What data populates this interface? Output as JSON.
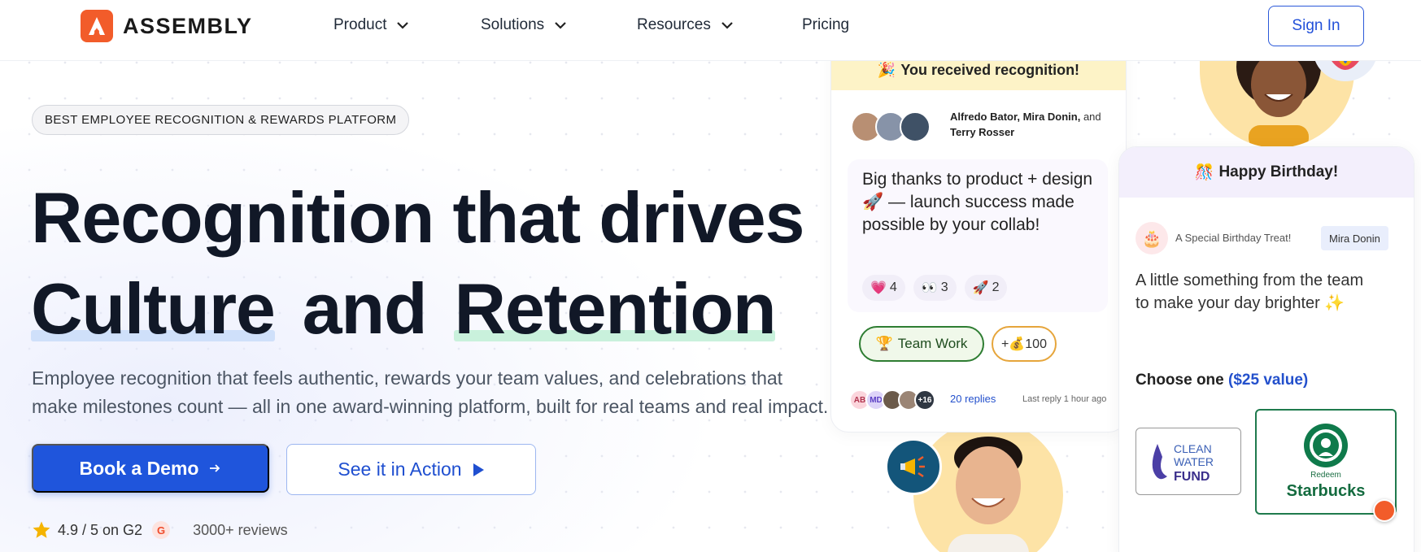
{
  "nav": {
    "logo_text": "ASSEMBLY",
    "items": [
      {
        "label": "Product",
        "has_dropdown": true
      },
      {
        "label": "Solutions",
        "has_dropdown": true
      },
      {
        "label": "Resources",
        "has_dropdown": true
      },
      {
        "label": "Pricing",
        "has_dropdown": false
      }
    ],
    "sign_in": "Sign In"
  },
  "hero": {
    "badge": "BEST EMPLOYEE RECOGNITION & REWARDS PLATFORM",
    "title_line1": "Recognition that drives",
    "title_word1": "Culture",
    "title_word2": "and",
    "title_word3": "Retention",
    "subtitle": "Employee recognition that feels authentic, rewards your team values, and celebrations that make milestones count — all in one award-winning platform, built for real teams and real impact.",
    "cta_primary": "Book a Demo",
    "cta_secondary": "See it in Action",
    "rating": "4.9 / 5 on G2",
    "g2": "G",
    "reviews": "3000+ reviews"
  },
  "recognition_card": {
    "header": "You received recognition!",
    "header_icon": "party-popper-icon",
    "senders": "Alfredo Bator, Mira Donin,",
    "senders_and": " and",
    "senders_last": "Terry Rosser",
    "message": "Big thanks to product + design 🚀 — launch success made possible by your collab!",
    "reactions": [
      {
        "emoji": "💗",
        "count": "4"
      },
      {
        "emoji": "👀",
        "count": "3"
      },
      {
        "emoji": "🚀",
        "count": "2"
      }
    ],
    "value_tag": "Team Work",
    "points": "+💰100",
    "reply_avatars": [
      "AB",
      "MD",
      "",
      "",
      "+16"
    ],
    "replies": "20 replies",
    "last_reply": "Last reply 1 hour ago"
  },
  "birthday_card": {
    "header": "Happy Birthday!",
    "header_icon": "gift-icon",
    "treat": "A Special Birthday Treat!",
    "recipient": "Mira Donin",
    "message": "A little something from the team to make your day brighter ✨",
    "choose": "Choose one",
    "choose_value": "($25 value)",
    "option1_lines": [
      "CLEAN",
      "WATER",
      "FUND"
    ],
    "option2_redeem": "Redeem",
    "option2_name": "Starbucks"
  },
  "colors": {
    "brand": "#f25c2a",
    "primary": "#1f55dc",
    "starbucks_green": "#0f7a4b"
  }
}
